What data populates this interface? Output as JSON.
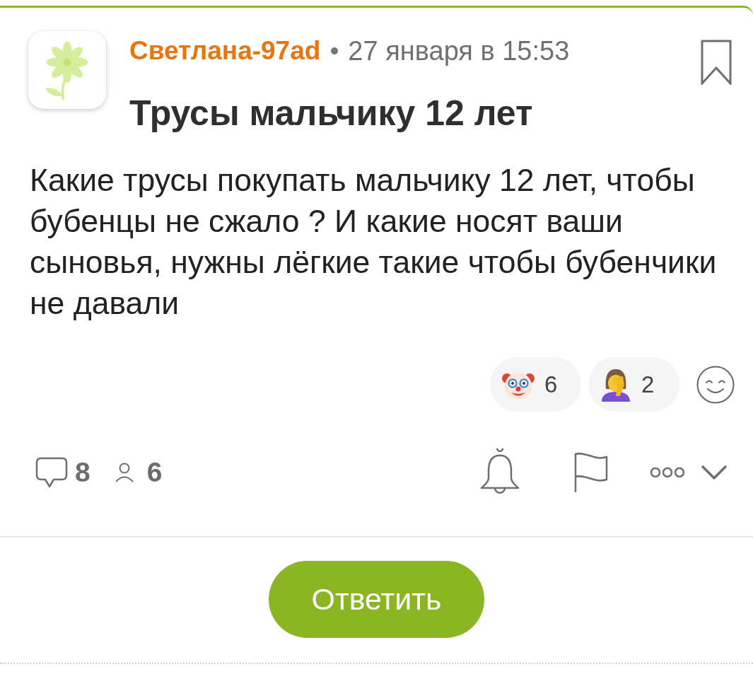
{
  "post": {
    "author": "Светлана-97ad",
    "separator": "•",
    "date": "27 января в 15:53",
    "title": "Трусы мальчику 12 лет",
    "body": "Какие трусы покупать мальчику 12 лет, чтобы бубенцы не сжало ? И какие носят ваши сыновья, нужны лёгкие такие чтобы бубенчики не давали"
  },
  "reactions": [
    {
      "kind": "clown",
      "count": "6"
    },
    {
      "kind": "facepalm",
      "count": "2"
    }
  ],
  "stats": [
    {
      "kind": "comments",
      "count": "8"
    },
    {
      "kind": "participants",
      "count": "6"
    }
  ],
  "actions": [
    {
      "kind": "subscribe"
    },
    {
      "kind": "report"
    },
    {
      "kind": "more"
    },
    {
      "kind": "expand"
    }
  ],
  "reply_button": {
    "label": "Ответить"
  }
}
